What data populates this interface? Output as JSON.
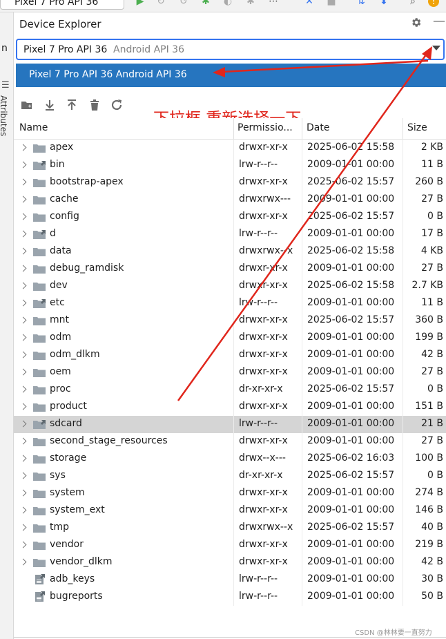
{
  "toolbar": {
    "device_tab_label": "Pixel 7 Pro API 36"
  },
  "left_strip": {
    "label_n": "n",
    "label_attributes": "Attributes"
  },
  "panel": {
    "title": "Device Explorer"
  },
  "device_select": {
    "device_name": "Pixel 7 Pro API 36",
    "device_api": "Android API 36",
    "option_label": "Pixel 7 Pro API 36 Android API 36"
  },
  "annotation": {
    "text": "下拉框 重新选择一下",
    "color": "#e0261c"
  },
  "colors": {
    "accent": "#3574f0",
    "selection": "#2675bf",
    "selected_row": "#d5d5d5",
    "folder": "#9aa4ad"
  },
  "table": {
    "headers": {
      "name": "Name",
      "permissions": "Permissio...",
      "date": "Date",
      "size": "Size"
    },
    "rows": [
      {
        "name": "apex",
        "perm": "drwxr-xr-x",
        "date": "2025-06-02 15:58",
        "size": "2 KB",
        "kind": "folder",
        "expandable": true
      },
      {
        "name": "bin",
        "perm": "lrw-r--r--",
        "date": "2009-01-01 00:00",
        "size": "11 B",
        "kind": "link-folder",
        "expandable": true
      },
      {
        "name": "bootstrap-apex",
        "perm": "drwxr-xr-x",
        "date": "2025-06-02 15:57",
        "size": "260 B",
        "kind": "folder",
        "expandable": true
      },
      {
        "name": "cache",
        "perm": "drwxrwx---",
        "date": "2009-01-01 00:00",
        "size": "27 B",
        "kind": "folder",
        "expandable": true
      },
      {
        "name": "config",
        "perm": "drwxr-xr-x",
        "date": "2025-06-02 15:57",
        "size": "0 B",
        "kind": "folder",
        "expandable": true
      },
      {
        "name": "d",
        "perm": "lrw-r--r--",
        "date": "2009-01-01 00:00",
        "size": "17 B",
        "kind": "link-folder",
        "expandable": true
      },
      {
        "name": "data",
        "perm": "drwxrwx--x",
        "date": "2025-06-02 15:58",
        "size": "4 KB",
        "kind": "folder",
        "expandable": true
      },
      {
        "name": "debug_ramdisk",
        "perm": "drwxr-xr-x",
        "date": "2009-01-01 00:00",
        "size": "27 B",
        "kind": "folder",
        "expandable": true
      },
      {
        "name": "dev",
        "perm": "drwxr-xr-x",
        "date": "2025-06-02 15:58",
        "size": "2.7 KB",
        "kind": "folder",
        "expandable": true
      },
      {
        "name": "etc",
        "perm": "lrw-r--r--",
        "date": "2009-01-01 00:00",
        "size": "11 B",
        "kind": "link-folder",
        "expandable": true
      },
      {
        "name": "mnt",
        "perm": "drwxr-xr-x",
        "date": "2025-06-02 15:57",
        "size": "360 B",
        "kind": "folder",
        "expandable": true
      },
      {
        "name": "odm",
        "perm": "drwxr-xr-x",
        "date": "2009-01-01 00:00",
        "size": "199 B",
        "kind": "folder",
        "expandable": true
      },
      {
        "name": "odm_dlkm",
        "perm": "drwxr-xr-x",
        "date": "2009-01-01 00:00",
        "size": "42 B",
        "kind": "folder",
        "expandable": true
      },
      {
        "name": "oem",
        "perm": "drwxr-xr-x",
        "date": "2009-01-01 00:00",
        "size": "27 B",
        "kind": "folder",
        "expandable": true
      },
      {
        "name": "proc",
        "perm": "dr-xr-xr-x",
        "date": "2025-06-02 15:57",
        "size": "0 B",
        "kind": "folder",
        "expandable": true
      },
      {
        "name": "product",
        "perm": "drwxr-xr-x",
        "date": "2009-01-01 00:00",
        "size": "151 B",
        "kind": "folder",
        "expandable": true
      },
      {
        "name": "sdcard",
        "perm": "lrw-r--r--",
        "date": "2009-01-01 00:00",
        "size": "21 B",
        "kind": "link-folder",
        "expandable": true,
        "selected": true
      },
      {
        "name": "second_stage_resources",
        "perm": "drwxr-xr-x",
        "date": "2009-01-01 00:00",
        "size": "27 B",
        "kind": "folder",
        "expandable": true
      },
      {
        "name": "storage",
        "perm": "drwx--x---",
        "date": "2025-06-02 16:03",
        "size": "100 B",
        "kind": "folder",
        "expandable": true
      },
      {
        "name": "sys",
        "perm": "dr-xr-xr-x",
        "date": "2025-06-02 15:57",
        "size": "0 B",
        "kind": "folder",
        "expandable": true
      },
      {
        "name": "system",
        "perm": "drwxr-xr-x",
        "date": "2009-01-01 00:00",
        "size": "274 B",
        "kind": "folder",
        "expandable": true
      },
      {
        "name": "system_ext",
        "perm": "drwxr-xr-x",
        "date": "2009-01-01 00:00",
        "size": "146 B",
        "kind": "folder",
        "expandable": true
      },
      {
        "name": "tmp",
        "perm": "drwxrwx--x",
        "date": "2025-06-02 15:57",
        "size": "40 B",
        "kind": "folder",
        "expandable": true
      },
      {
        "name": "vendor",
        "perm": "drwxr-xr-x",
        "date": "2009-01-01 00:00",
        "size": "219 B",
        "kind": "folder",
        "expandable": true
      },
      {
        "name": "vendor_dlkm",
        "perm": "drwxr-xr-x",
        "date": "2009-01-01 00:00",
        "size": "42 B",
        "kind": "folder",
        "expandable": true
      },
      {
        "name": "adb_keys",
        "perm": "lrw-r--r--",
        "date": "2009-01-01 00:00",
        "size": "30 B",
        "kind": "link-file",
        "expandable": false
      },
      {
        "name": "bugreports",
        "perm": "lrw-r--r--",
        "date": "2009-01-01 00:00",
        "size": "50 B",
        "kind": "link-file",
        "expandable": false
      }
    ]
  },
  "watermark": "CSDN @林林要一直努力"
}
